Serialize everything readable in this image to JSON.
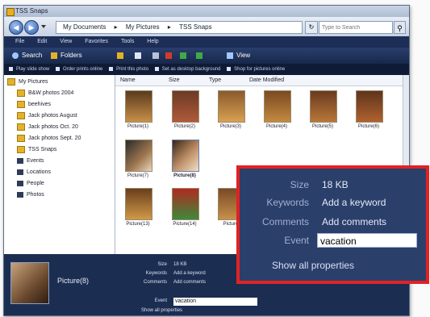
{
  "window": {
    "title": "TSS Snaps"
  },
  "address": {
    "crumbs": [
      "My Documents",
      "My Pictures",
      "TSS Snaps"
    ],
    "separator": "▸",
    "search_placeholder": "Type to Search",
    "back_icon": "back-arrow-icon",
    "forward_icon": "forward-arrow-icon"
  },
  "menu": [
    "File",
    "Edit",
    "View",
    "Favorites",
    "Tools",
    "Help"
  ],
  "toolbar": {
    "search": "Search",
    "folders": "Folders",
    "view": "View"
  },
  "tasks": [
    "Play slide show",
    "Order prints online",
    "Print this photo",
    "Set as desktop background",
    "Shop for pictures online"
  ],
  "nav": {
    "root": "My Pictures",
    "items": [
      "B&W photos 2004",
      "beehives",
      "Jack photos August",
      "Jack photos Oct. 20",
      "Jack photos Sept. 20",
      "TSS Snaps",
      "Events",
      "Locations",
      "People",
      "Photos"
    ]
  },
  "columns": [
    "Name",
    "Size",
    "Type",
    "Date Modified"
  ],
  "files": [
    "Picture(1)",
    "Picture(2)",
    "Picture(3)",
    "Picture(4)",
    "Picture(5)",
    "Picture(6)",
    "Picture(7)",
    "Picture(8)",
    "Picture(13)",
    "Picture(14)",
    "Picture"
  ],
  "details": {
    "name": "Picture(8)",
    "labels": [
      "Size",
      "Keywords",
      "Comments",
      "Event"
    ],
    "values": [
      "18 KB",
      "Add a keyword",
      "Add comments",
      "vacation"
    ],
    "show_all": "Show all properties"
  },
  "callout": {
    "labels": [
      "Size",
      "Keywords",
      "Comments",
      "Event"
    ],
    "values": [
      "18 KB",
      "Add a keyword",
      "Add comments"
    ],
    "event_value": "vacation",
    "show_all": "Show all properties",
    "border_color": "#e12222"
  }
}
